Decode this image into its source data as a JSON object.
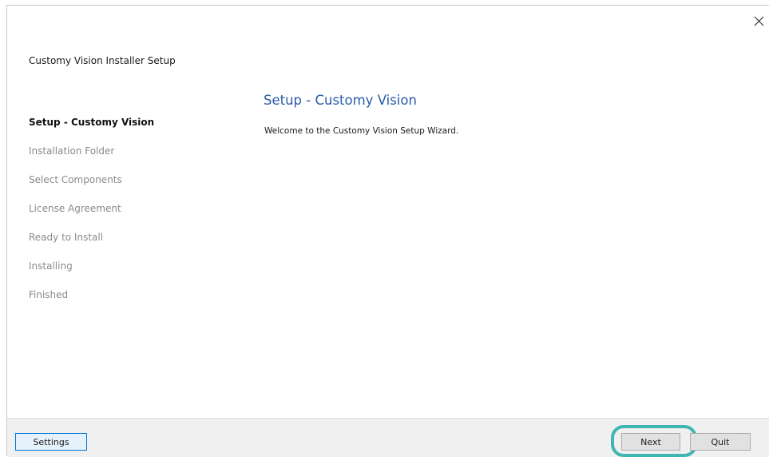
{
  "window": {
    "title": "Customy Vision Installer Setup",
    "close_icon": "close-icon"
  },
  "sidebar": {
    "steps": [
      {
        "label": "Setup - Customy Vision",
        "state": "active"
      },
      {
        "label": "Installation Folder",
        "state": "pending"
      },
      {
        "label": "Select Components",
        "state": "pending"
      },
      {
        "label": "License Agreement",
        "state": "pending"
      },
      {
        "label": "Ready to Install",
        "state": "pending"
      },
      {
        "label": "Installing",
        "state": "pending"
      },
      {
        "label": "Finished",
        "state": "pending"
      }
    ]
  },
  "main": {
    "heading": "Setup - Customy Vision",
    "welcome": "Welcome to the Customy Vision Setup Wizard."
  },
  "footer": {
    "settings_label": "Settings",
    "next_label": "Next",
    "quit_label": "Quit"
  },
  "colors": {
    "heading": "#2a5ca8",
    "highlight": "#3fb6b0",
    "active_step": "#111111",
    "pending_step": "#8a8a8a"
  }
}
